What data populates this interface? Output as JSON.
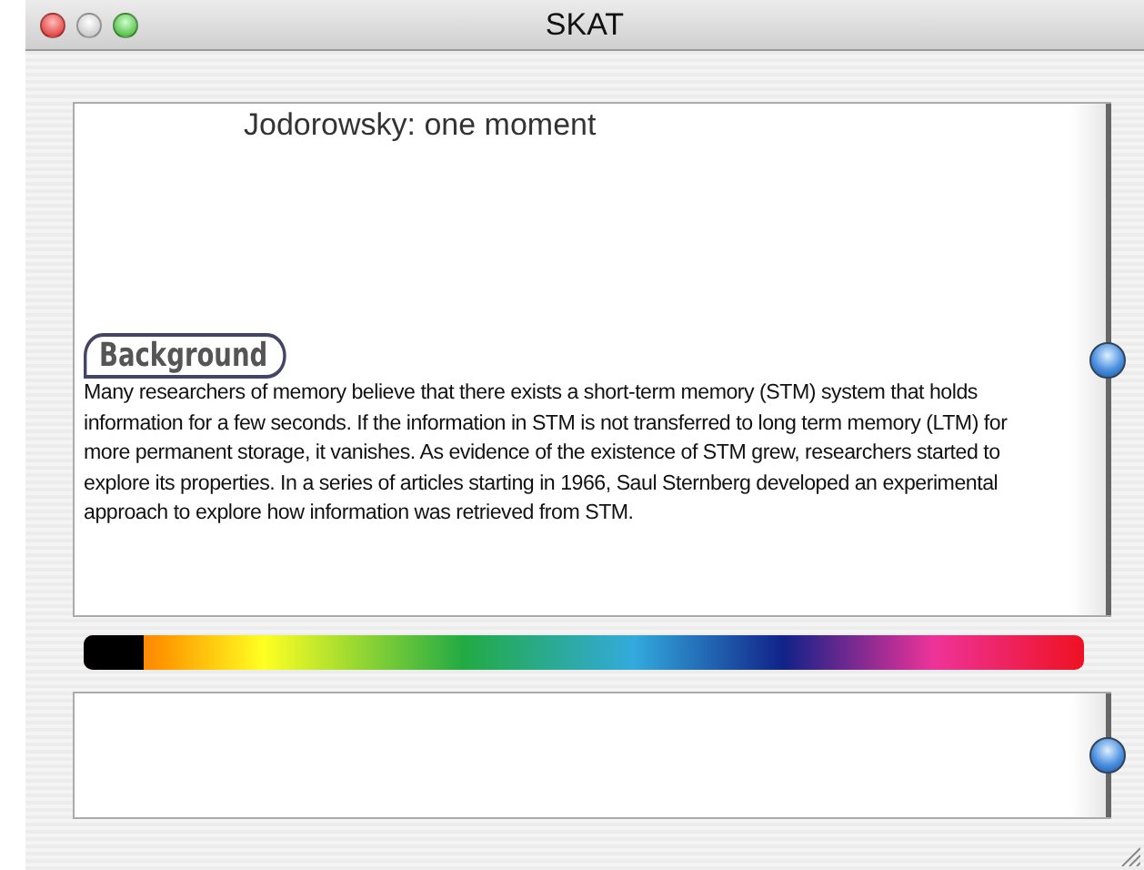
{
  "window": {
    "title": "SKAT"
  },
  "top_panel": {
    "heading": "Jodorowsky: one moment",
    "section_label": "Background",
    "body": "Many researchers of memory believe that there exists a short-term memory (STM) system that holds information for a few seconds. If the information in STM is not transferred to long term memory (LTM) for more permanent storage, it vanishes. As evidence of the existence of STM grew, researchers started to explore its properties. In a series of articles starting in 1966, Saul Sternberg developed an experimental approach to explore how information was retrieved from STM.",
    "slider": {
      "level": 0.5
    }
  },
  "color_bar": {
    "level": 0.06
  },
  "bottom_panel": {
    "slider": {
      "level": 0.5
    }
  }
}
